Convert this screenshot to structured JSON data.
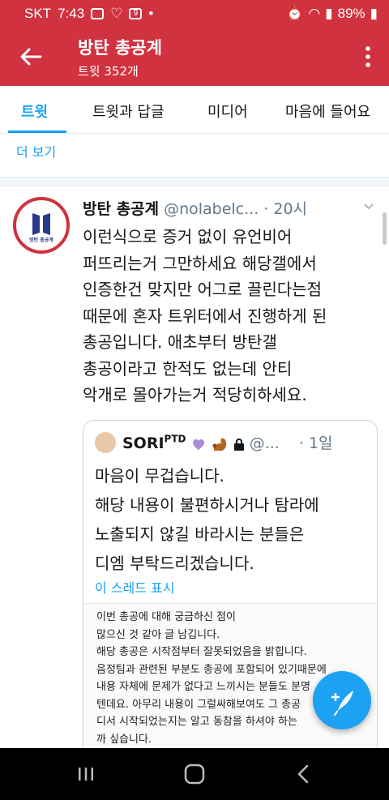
{
  "status_bar": {
    "carrier": "SKT",
    "time": "7:43",
    "battery": "89%"
  },
  "header": {
    "title": "방탄 총공계",
    "subtitle": "트윗 352개"
  },
  "tabs": [
    {
      "label": "트윗",
      "active": true
    },
    {
      "label": "트윗과 답글",
      "active": false
    },
    {
      "label": "미디어",
      "active": false
    },
    {
      "label": "마음에 들어요",
      "active": false
    }
  ],
  "show_more": "더 보기",
  "tweet": {
    "name": "방탄 총공계",
    "handle": "@nolabelc...",
    "time": "· 20시",
    "avatar_logo_text": "방탄 총공계",
    "text": "이런식으로 증거 없이 유언비어\n퍼뜨리는거 그만하세요 해당갤에서\n인증한건 맞지만 어그로 끌린다는점\n때문에 혼자 트위터에서 진행하게 된\n총공입니다. 애초부터 방탄갤\n총공이라고 한적도 없는데 안티\n악개로 몰아가는거 적당히하세요."
  },
  "quote": {
    "name": "SORI",
    "name_sup": "PTD",
    "handle": "@...",
    "time": "· 1일",
    "text": "마음이 무겁습니다.\n해당 내용이 불편하시거나 탐라에\n노출되지 않길 바라시는 분들은\n디엠 부탁드리겠습니다.",
    "thread_link": "이 스레드 표시",
    "image_text": "이번 총공에 대해 궁금하신 점이\n많으신 것 같아 글 남깁니다.\n해당 총공은 시작점부터 잘못되었음을 밝힙니다.\n음정팀과 관련된 부분도 총공에 포함되어 있기때문에\n내용 자체에 문제가 없다고 느끼시는 분들도 분명\n텐데요. 아무리 내용이 그럴싸해보여도 그 총공\n디서 시작되었는지는 알고 동참을 하셔야 하는\n까 싶습니다.\n해당 총공계는 디씨인사이드 방탄소년단 갤러리에서 시"
  },
  "colors": {
    "brand_red": "#d0323f",
    "twitter_blue": "#1da1f2"
  },
  "icons": [
    "back-arrow-icon",
    "more-vert-icon",
    "compose-tweet-icon",
    "chevron-down-icon"
  ]
}
